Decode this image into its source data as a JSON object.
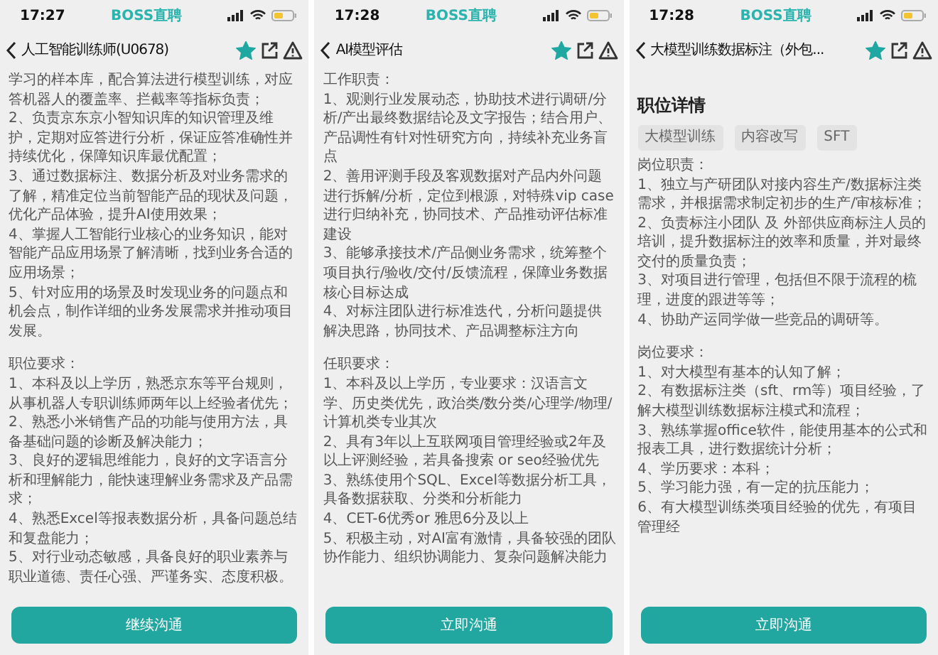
{
  "panels": [
    {
      "status_bar": {
        "time": "17:27",
        "app_label": "BOSS直聘"
      },
      "header": {
        "title": "人工智能训练师(U0678)",
        "favorited": true
      },
      "blocks": [
        {
          "kind": "para",
          "text": "学习的样本库，配合算法进行模型训练，对应答机器人的覆盖率、拦截率等指标负责；"
        },
        {
          "kind": "para",
          "text": "2、负责京东京小智知识库的知识管理及维护，定期对应答进行分析，保证应答准确性并持续优化，保障知识库最优配置；"
        },
        {
          "kind": "para",
          "text": "3、通过数据标注、数据分析及对业务需求的了解，精准定位当前智能产品的现状及问题，优化产品体验，提升AI使用效果；"
        },
        {
          "kind": "para",
          "text": "4、掌握人工智能行业核心的业务知识，能对智能产品应用场景了解清晰，找到业务合适的应用场景；"
        },
        {
          "kind": "para",
          "text": "5、针对应用的场景及时发现业务的问题点和机会点，制作详细的业务发展需求并推动项目发展。"
        },
        {
          "kind": "section",
          "text": "职位要求："
        },
        {
          "kind": "para",
          "text": "1、本科及以上学历，熟悉京东等平台规则，从事机器人专职训练师两年以上经验者优先；"
        },
        {
          "kind": "para",
          "text": "2、熟悉小米销售产品的功能与使用方法，具备基础问题的诊断及解决能力；"
        },
        {
          "kind": "para",
          "text": "3、良好的逻辑思维能力，良好的文字语言分析和理解能力，能快速理解业务需求及产品需求；"
        },
        {
          "kind": "para",
          "text": "4、熟悉Excel等报表数据分析，具备问题总结和复盘能力；"
        },
        {
          "kind": "para",
          "text": "5、对行业动态敏感，具备良好的职业素养与职业道德、责任心强、严谨务实、态度积极。"
        }
      ],
      "button": "继续沟通"
    },
    {
      "status_bar": {
        "time": "17:28",
        "app_label": "BOSS直聘"
      },
      "header": {
        "title": "AI模型评估",
        "favorited": true
      },
      "blocks": [
        {
          "kind": "para",
          "text": "工作职责："
        },
        {
          "kind": "para",
          "text": "1、观测行业发展动态，协助技术进行调研/分析/产出最终数据结论及文字报告；结合用户、产品调性有针对性研究方向，持续补充业务盲点"
        },
        {
          "kind": "para",
          "text": "2、善用评测手段及客观数据对产品内外问题进行拆解/分析，定位到根源，对特殊vip case进行归纳补充，协同技术、产品推动评估标准建设"
        },
        {
          "kind": "para",
          "text": "3、能够承接技术/产品侧业务需求，统筹整个项目执行/验收/交付/反馈流程，保障业务数据核心目标达成"
        },
        {
          "kind": "para",
          "text": "4、对标注团队进行标准迭代，分析问题提供解决思路，协同技术、产品调整标注方向"
        },
        {
          "kind": "section",
          "text": "任职要求："
        },
        {
          "kind": "para",
          "text": "1、本科及以上学历，专业要求：汉语言文学、历史类优先，政治类/数分类/心理学/物理/计算机类专业其次"
        },
        {
          "kind": "para",
          "text": "2、具有3年以上互联网项目管理经验或2年及以上评测经验，若具备搜索 or seo经验优先"
        },
        {
          "kind": "para",
          "text": "3、熟练使用个SQL、Excel等数据分析工具，具备数据获取、分类和分析能力"
        },
        {
          "kind": "para",
          "text": "4、CET-6优秀or 雅思6分及以上"
        },
        {
          "kind": "para",
          "text": "5、积极主动，对AI富有激情，具备较强的团队协作能力、组织协调能力、复杂问题解决能力"
        }
      ],
      "button": "立即沟通"
    },
    {
      "status_bar": {
        "time": "17:28",
        "app_label": "BOSS直聘"
      },
      "header": {
        "title": "大模型训练数据标注（外包...",
        "favorited": true
      },
      "blocks": [
        {
          "kind": "title",
          "text": "职位详情"
        },
        {
          "kind": "tags",
          "tags": [
            "大模型训练",
            "内容改写",
            "SFT"
          ]
        },
        {
          "kind": "para",
          "text": "岗位职责："
        },
        {
          "kind": "para",
          "text": "1、独立与产研团队对接内容生产/数据标注类需求，并根据需求制定初步的生产/审核标准；"
        },
        {
          "kind": "para",
          "text": "2、负责标注小团队 及 外部供应商标注人员的培训，提升数据标注的效率和质量，并对最终交付的质量负责；"
        },
        {
          "kind": "para",
          "text": "3、对项目进行管理，包括但不限于流程的梳理，进度的跟进等等；"
        },
        {
          "kind": "para",
          "text": "4、协助产运同学做一些竞品的调研等。"
        },
        {
          "kind": "section",
          "text": "岗位要求："
        },
        {
          "kind": "para",
          "text": "1、对大模型有基本的认知了解；"
        },
        {
          "kind": "para",
          "text": "2、有数据标注类（sft、rm等）项目经验，了解大模型训练数据标注模式和流程；"
        },
        {
          "kind": "para",
          "text": "3、熟练掌握office软件，能使用基本的公式和报表工具，进行数据统计分析；"
        },
        {
          "kind": "para",
          "text": "4、学历要求：本科；"
        },
        {
          "kind": "para",
          "text": "5、学习能力强，有一定的抗压能力；"
        },
        {
          "kind": "para",
          "text": "6、有大模型训练类项目经验的优先，有项目管理经"
        }
      ],
      "button": "立即沟通"
    }
  ]
}
